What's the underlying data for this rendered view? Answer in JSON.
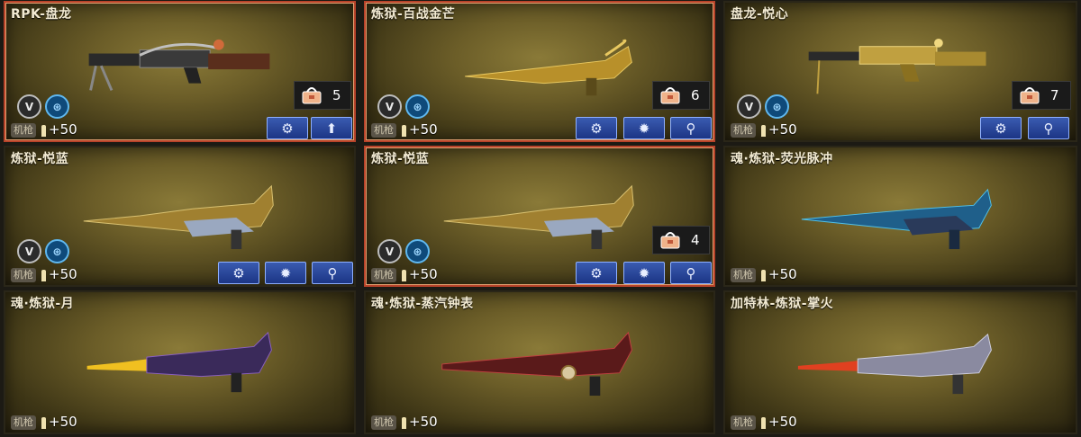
{
  "cards": [
    {
      "title": "RPK-盘龙",
      "tag": "机枪",
      "ammo": "+50",
      "count": "5",
      "selected": true
    },
    {
      "title": "炼狱-百战金芒",
      "tag": "机枪",
      "ammo": "+50",
      "count": "6",
      "selected": true
    },
    {
      "title": "盘龙-悦心",
      "tag": "机枪",
      "ammo": "+50",
      "count": "7",
      "selected": false
    },
    {
      "title": "炼狱-悦蓝",
      "tag": "机枪",
      "ammo": "+50",
      "count": "",
      "selected": false
    },
    {
      "title": "炼狱-悦蓝",
      "tag": "机枪",
      "ammo": "+50",
      "count": "4",
      "selected": true
    },
    {
      "title": "魂·炼狱-荧光脉冲",
      "tag": "机枪",
      "ammo": "+50",
      "count": "",
      "selected": false
    },
    {
      "title": "魂·炼狱-月",
      "tag": "机枪",
      "ammo": "+50",
      "count": "",
      "selected": false
    },
    {
      "title": "魂·炼狱-蒸汽钟表",
      "tag": "机枪",
      "ammo": "+50",
      "count": "",
      "selected": false
    },
    {
      "title": "加特林-炼狱-掌火",
      "tag": "机枪",
      "ammo": "+50",
      "count": "",
      "selected": false
    }
  ],
  "badges": {
    "v": "V"
  },
  "icons": {
    "customize": "wrench-gear-icon",
    "settings": "gear-icon",
    "search": "magnifier-icon",
    "upgrade": "arrow-up-icon",
    "bag": "bag-icon"
  },
  "colors": {
    "button": "#2a48a0",
    "selected_border": "#b8432a",
    "panel": "#6b5d28"
  }
}
